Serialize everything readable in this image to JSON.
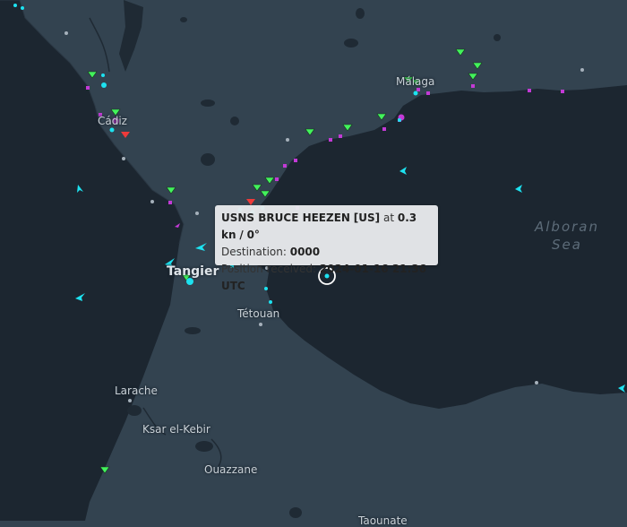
{
  "sea_label": {
    "line1": "Alboran",
    "line2": "Sea"
  },
  "cities": {
    "malaga": "Málaga",
    "cadiz": "Cádiz",
    "tangier": "Tangier",
    "tetouan": "Tétouan",
    "larache": "Larache",
    "ksar": "Ksar el-Kebir",
    "ouazzane": "Ouazzane",
    "taounate": "Taounate"
  },
  "tooltip": {
    "vessel_name": "USNS BRUCE HEEZEN",
    "flag": "[US]",
    "at_text": "at",
    "speed": "0.3 kn",
    "separator": "/",
    "heading": "0°",
    "destination_label": "Destination:",
    "destination_value": "0000",
    "position_label": "Position received:",
    "position_value": "2024-01-16 21:36 UTC"
  },
  "colors": {
    "land": "#334350",
    "sea": "#1c2630",
    "vessel_cyan": "#1de2f0",
    "marker_magenta": "#c33ad6",
    "anchor_green": "#43f25c",
    "anchor_red": "#ef3a3a"
  },
  "icons": [
    "selected-vessel-ring-icon",
    "vessel-arrow-icon",
    "anchored-vessel-icon",
    "port-dot-icon"
  ]
}
